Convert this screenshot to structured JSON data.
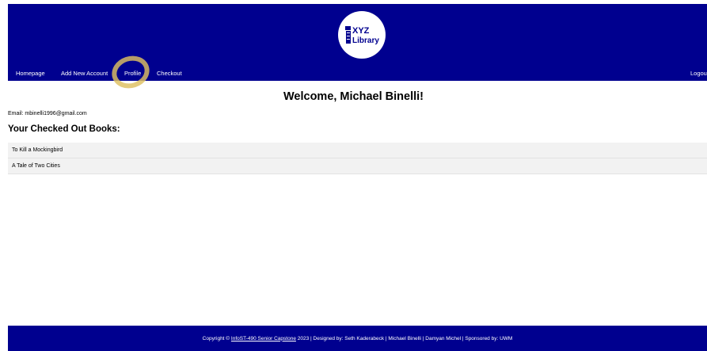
{
  "header": {
    "logo": {
      "line1": "XYZ",
      "line2": "Library"
    },
    "nav": {
      "homepage": "Homepage",
      "add_account": "Add New Account",
      "profile": "Profile",
      "checkout": "Checkout",
      "logout": "Logout"
    }
  },
  "main": {
    "welcome": "Welcome, Michael Binelli!",
    "email": "Email: mbinelli1996@gmail.com",
    "checked_out_heading": "Your Checked Out Books:",
    "books": [
      "To Kill a Mockingbird",
      "A Tale of Two Cities"
    ]
  },
  "footer": {
    "prefix": "Copyright ©",
    "link": "InfoST-490 Senior Capstone",
    "suffix": "2023 | Designed by: Seth Kaderabeck | Michael Binelli | Damyan Michel | Sponsored by: UWM"
  },
  "colors": {
    "header_bg": "#00008f",
    "footer_bg": "#00008f",
    "highlight": "#debf60",
    "row_bg": "#f2f2f2"
  }
}
